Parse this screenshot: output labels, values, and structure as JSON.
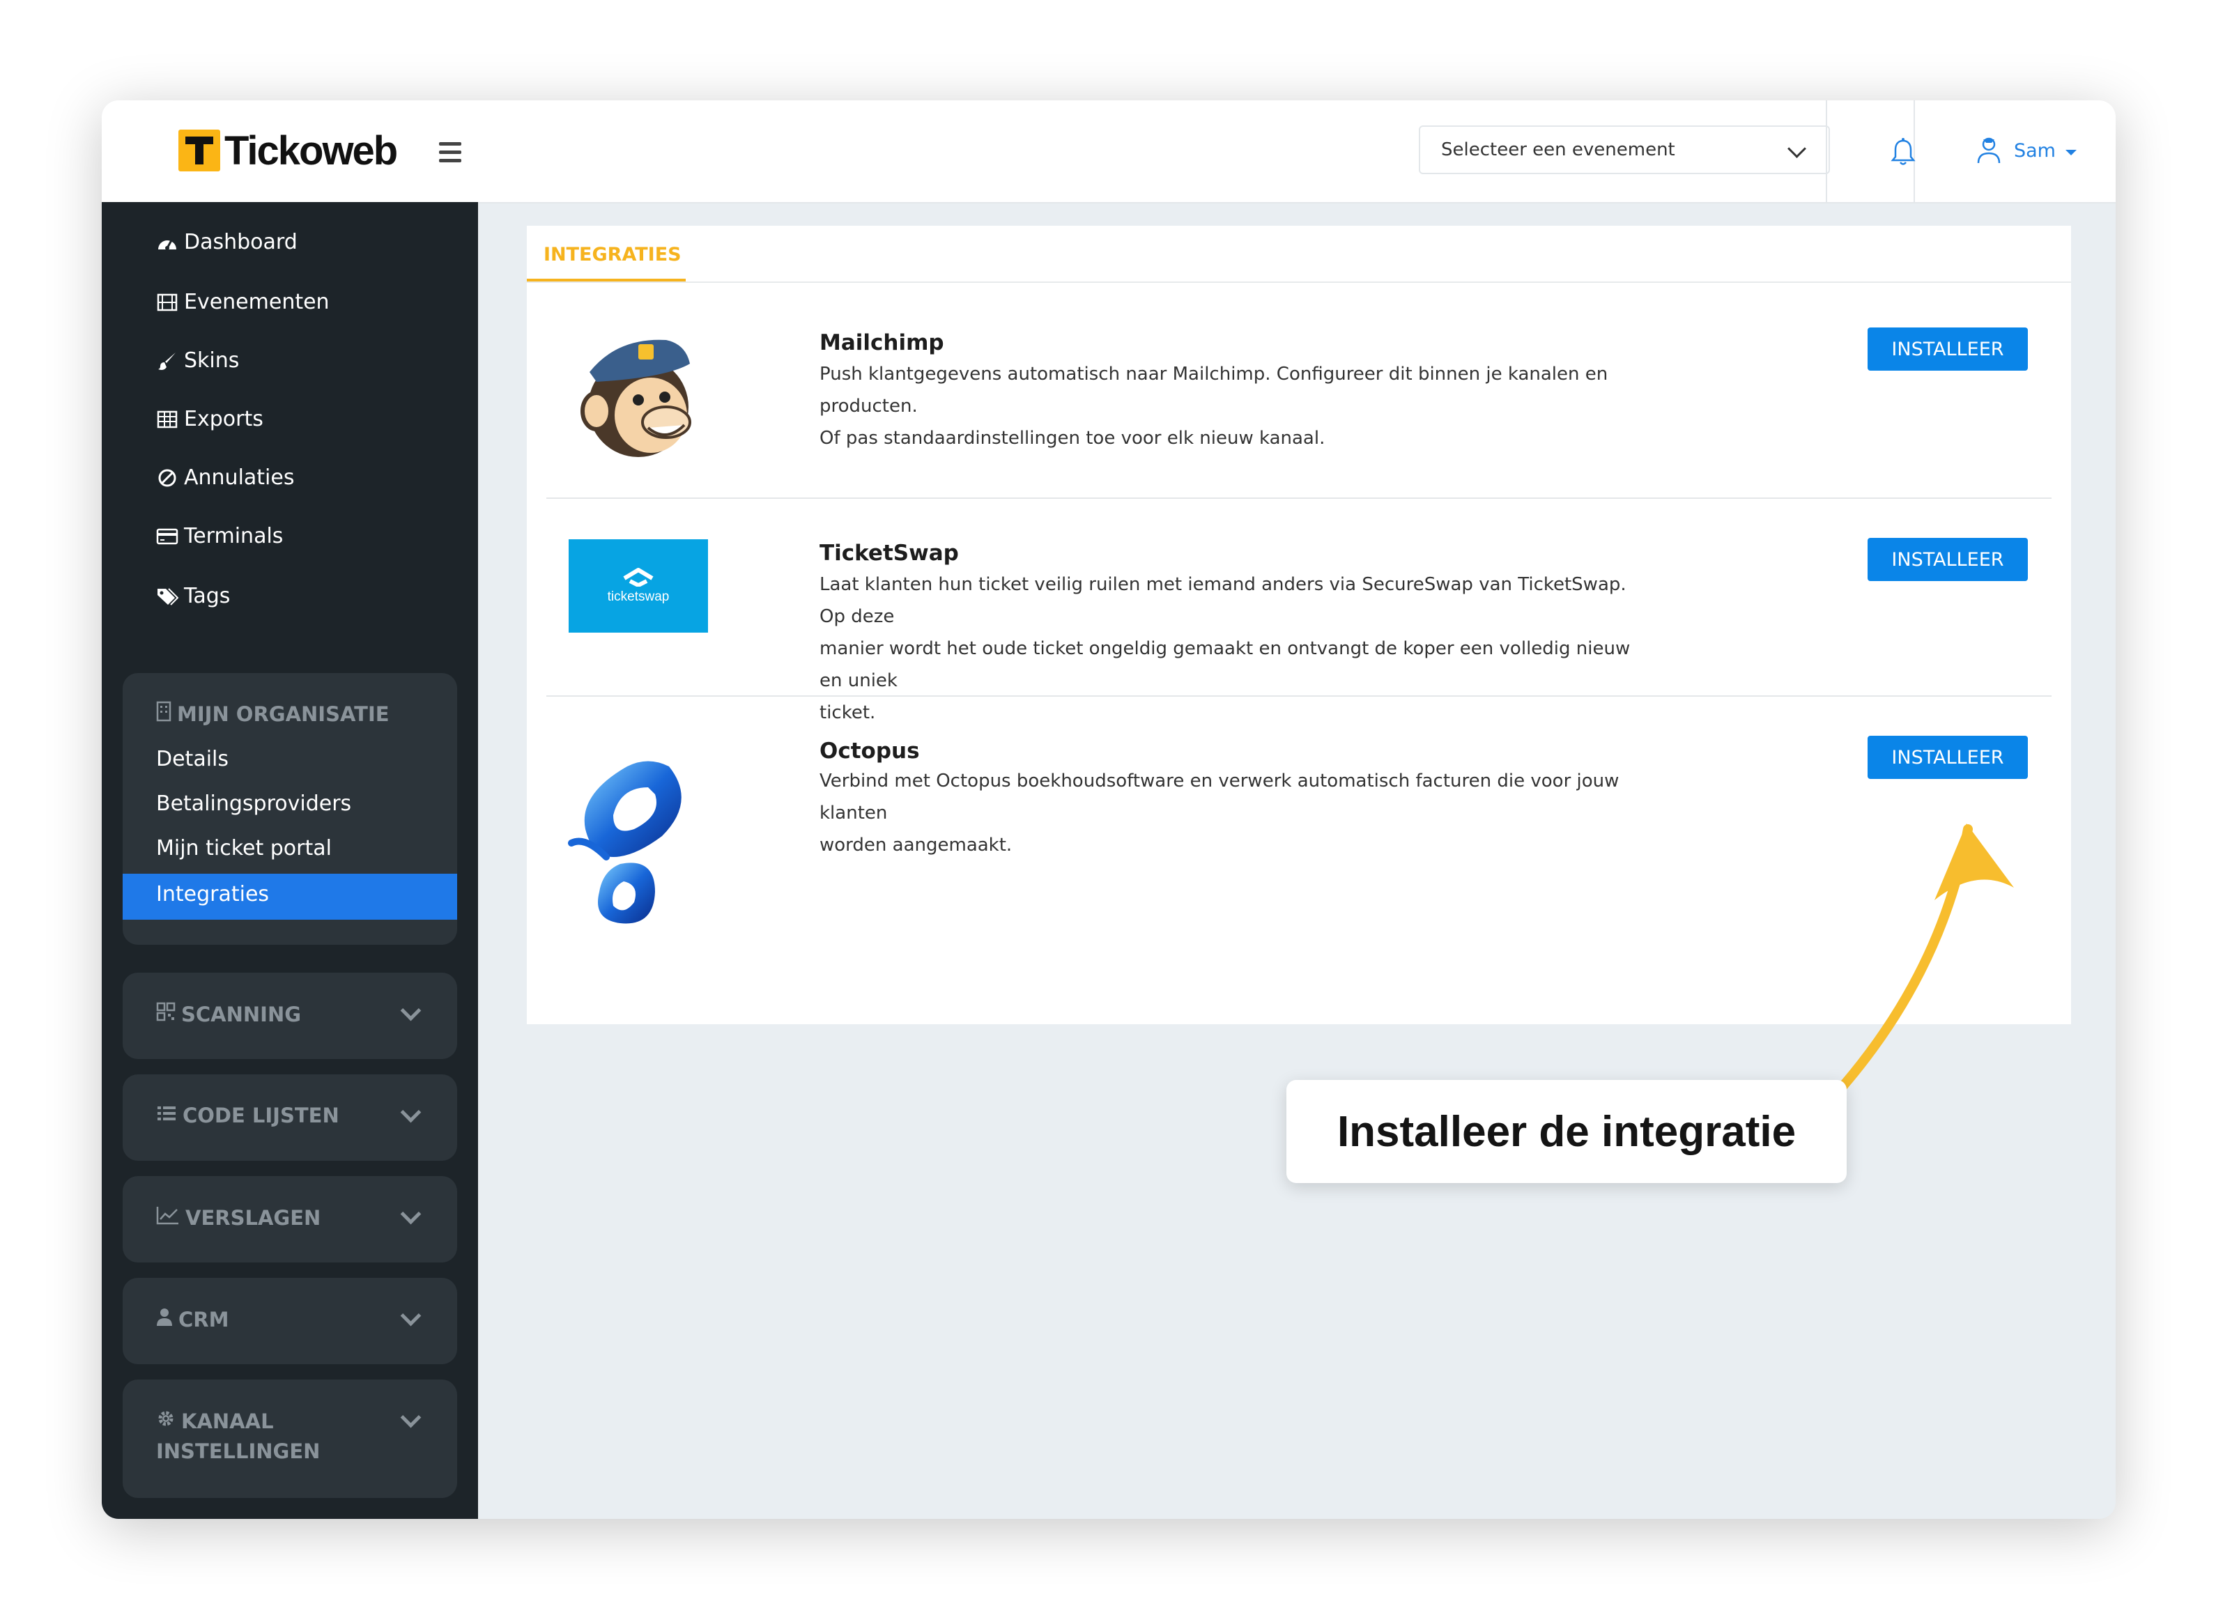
{
  "app": {
    "brand_name": "Tickoweb"
  },
  "header": {
    "event_select": {
      "value": "Selecteer een evenement"
    },
    "user_name": "Sam"
  },
  "sidebar": {
    "items": [
      {
        "label": "Dashboard",
        "icon": "dashboard-icon"
      },
      {
        "label": "Evenementen",
        "icon": "film-icon"
      },
      {
        "label": "Skins",
        "icon": "brush-icon"
      },
      {
        "label": "Exports",
        "icon": "table-icon"
      },
      {
        "label": "Annulaties",
        "icon": "ban-icon"
      },
      {
        "label": "Terminals",
        "icon": "credit-card-icon"
      },
      {
        "label": "Tags",
        "icon": "tags-icon"
      }
    ],
    "organisation": {
      "title": "MIJN ORGANISATIE",
      "icon": "building-icon",
      "items": [
        "Details",
        "Betalingsproviders",
        "Mijn ticket portal",
        "Integraties"
      ],
      "active": "Integraties"
    },
    "groups": [
      {
        "title": "SCANNING",
        "icon": "qrcode-icon"
      },
      {
        "title": "CODE LIJSTEN",
        "icon": "list-icon"
      },
      {
        "title": "VERSLAGEN",
        "icon": "chart-line-icon"
      },
      {
        "title": "CRM",
        "icon": "user-icon"
      },
      {
        "title": "KANAAL",
        "title2": "INSTELLINGEN",
        "icon": "cog-icon"
      }
    ]
  },
  "content": {
    "tab_label": "INTEGRATIES",
    "integrations": [
      {
        "name": "Mailchimp",
        "desc1": "Push klantgegevens automatisch naar Mailchimp. Configureer dit binnen je kanalen en producten.",
        "desc2": "Of pas standaardinstellingen toe voor elk nieuw kanaal.",
        "button": "INSTALLEER"
      },
      {
        "name": "TicketSwap",
        "logo_text": "ticketswap",
        "desc1": "Laat klanten hun ticket veilig ruilen met iemand anders via SecureSwap van TicketSwap. Op deze",
        "desc2": "manier wordt het oude ticket ongeldig gemaakt en ontvangt de koper een volledig nieuw en uniek",
        "desc3": "ticket.",
        "button": "INSTALLEER"
      },
      {
        "name": "Octopus",
        "desc1": "Verbind met Octopus boekhoudsoftware en verwerk automatisch facturen die voor jouw klanten",
        "desc2": "worden aangemaakt.",
        "button": "INSTALLEER"
      }
    ]
  },
  "callout": {
    "text": "Installeer de integratie"
  },
  "colors": {
    "accent": "#f6b31e",
    "primary": "#0a85e8",
    "active_nav": "#1f79e8",
    "sidebar": "#1d2429",
    "arrow": "#f7bd2e"
  }
}
